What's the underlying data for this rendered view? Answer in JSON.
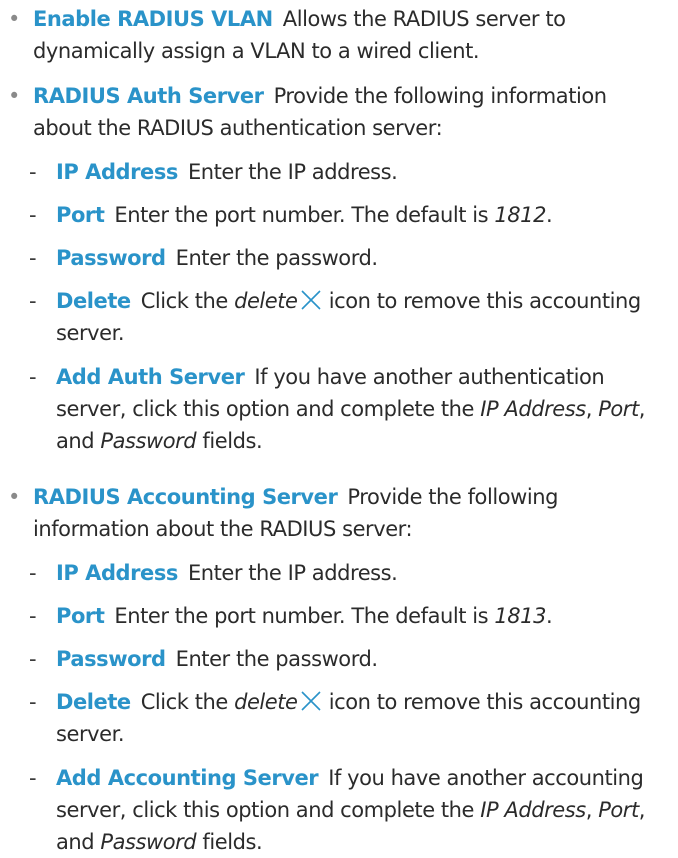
{
  "bullet_char": "•",
  "dash_char": "-",
  "icons": {
    "delete": "close-x-icon"
  },
  "colors": {
    "term": "#2a93c9",
    "text": "#2b2b2b",
    "bullet": "#8a8a8a"
  },
  "radius_vlan": {
    "term": "Enable RADIUS VLAN",
    "text": "Allows the RADIUS server to dynamically assign a VLAN to a wired client."
  },
  "auth_server": {
    "term": "RADIUS Auth Server",
    "text": "Provide the following information about the RADIUS authentication server:",
    "ip": {
      "term": "IP Address",
      "text": "Enter the IP address."
    },
    "port": {
      "term": "Port",
      "text": "Enter the port number. The default is ",
      "default": "1812",
      "end": "."
    },
    "password": {
      "term": "Password",
      "text": "Enter the password."
    },
    "delete": {
      "term": "Delete",
      "pre": "Click the ",
      "italic": "delete",
      "post": " icon to remove this accounting server."
    },
    "add": {
      "term": "Add Auth Server",
      "text": "If you have another authentication server, click this option and complete the ",
      "f1": "IP Address",
      "s1": ", ",
      "f2": "Port",
      "s2": ", and ",
      "f3": "Password",
      "end": " fields."
    }
  },
  "acct_server": {
    "term": "RADIUS Accounting Server",
    "text": "Provide the following information about the RADIUS server:",
    "ip": {
      "term": "IP Address",
      "text": "Enter the IP address."
    },
    "port": {
      "term": "Port",
      "text": "Enter the port number. The default is ",
      "default": "1813",
      "end": "."
    },
    "password": {
      "term": "Password",
      "text": "Enter the password."
    },
    "delete": {
      "term": "Delete",
      "pre": "Click the ",
      "italic": "delete",
      "post": " icon to remove this accounting server."
    },
    "add": {
      "term": "Add Accounting Server",
      "text": "If you have another accounting server, click this option and complete the ",
      "f1": "IP Address",
      "s1": ", ",
      "f2": "Port",
      "s2": ", and ",
      "f3": "Password",
      "end": " fields."
    }
  }
}
